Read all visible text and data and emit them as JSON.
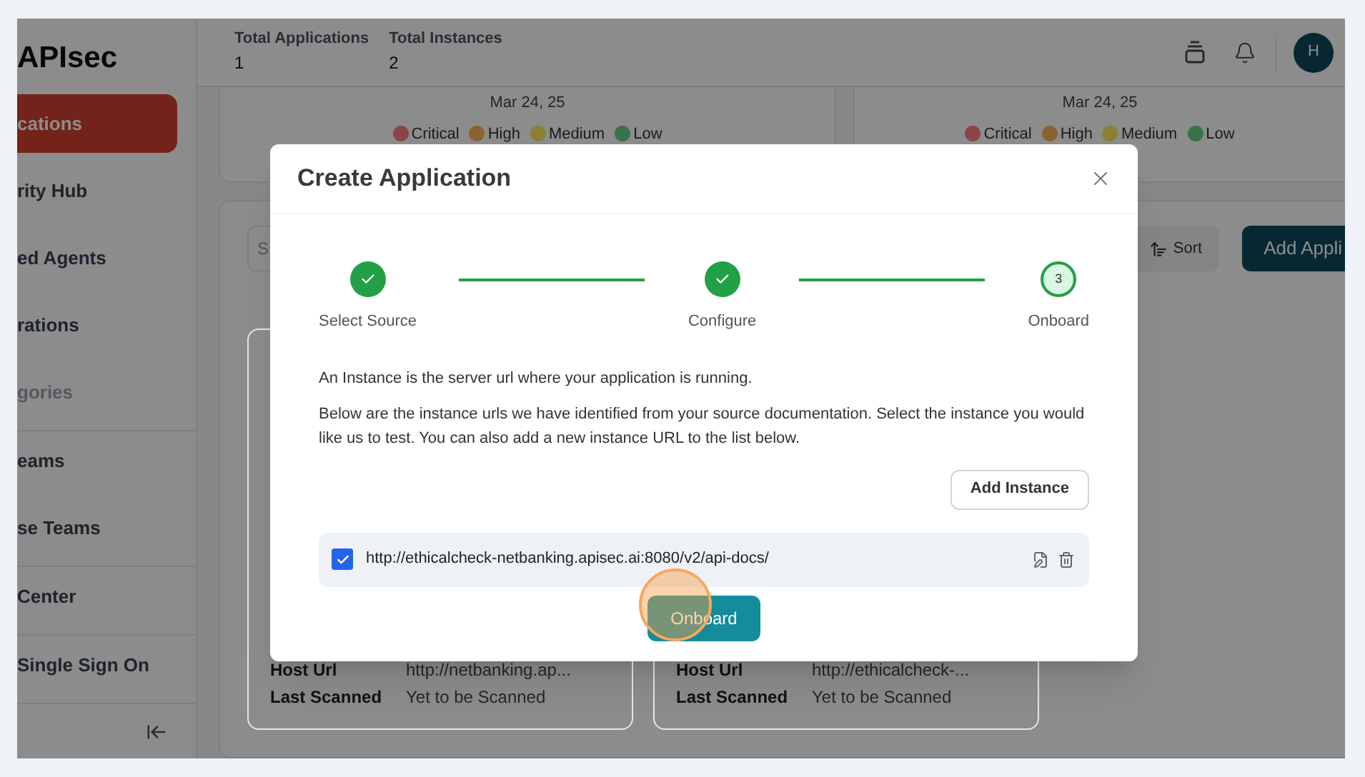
{
  "sidebar": {
    "logo": "APIsec",
    "items": [
      {
        "label": "cations",
        "selected": true,
        "disabled": false
      },
      {
        "label": "rity Hub",
        "selected": false,
        "disabled": false
      },
      {
        "label": "ed Agents",
        "selected": false,
        "disabled": false
      },
      {
        "label": "rations",
        "selected": false,
        "disabled": false
      },
      {
        "label": "gories",
        "selected": false,
        "disabled": true
      },
      {
        "label": "eams",
        "selected": false,
        "disabled": false
      },
      {
        "label": "se Teams",
        "selected": false,
        "disabled": false
      },
      {
        "label": "Center",
        "selected": false,
        "disabled": false
      },
      {
        "label": "Single Sign On",
        "selected": false,
        "disabled": false
      }
    ]
  },
  "header": {
    "stats": [
      {
        "label": "Total Applications",
        "value": "1"
      },
      {
        "label": "Total Instances",
        "value": "2"
      }
    ],
    "avatar": "H"
  },
  "charts": [
    {
      "date": "Mar 24, 25",
      "legend": [
        {
          "label": "Critical",
          "color": "#8a4646"
        },
        {
          "label": "High",
          "color": "#8a6332"
        },
        {
          "label": "Medium",
          "color": "#8c8034"
        },
        {
          "label": "Low",
          "color": "#3a7249"
        }
      ]
    },
    {
      "date": "Mar 24, 25",
      "legend": [
        {
          "label": "Critical",
          "color": "#8a4646"
        },
        {
          "label": "High",
          "color": "#8a6332"
        },
        {
          "label": "Medium",
          "color": "#8c8034"
        },
        {
          "label": "Low",
          "color": "#3a7249"
        }
      ]
    }
  ],
  "toolbar": {
    "search_placeholder": "S",
    "sort": "Sort",
    "add_button": "Add Appli"
  },
  "app_cards": [
    {
      "fields": [
        {
          "label": "Host Url",
          "value": "http://netbanking.ap..."
        },
        {
          "label": "Last Scanned",
          "value": "Yet to be Scanned"
        }
      ]
    },
    {
      "fields": [
        {
          "label": "Host Url",
          "value": "http://ethicalcheck-..."
        },
        {
          "label": "Last Scanned",
          "value": "Yet to be Scanned"
        }
      ]
    }
  ],
  "dialog": {
    "title": "Create Application",
    "steps": [
      {
        "label": "Select Source",
        "kind": "done"
      },
      {
        "label": "Configure",
        "kind": "done"
      },
      {
        "label": "Onboard",
        "kind": "current",
        "number": "3"
      }
    ],
    "paragraphs": [
      "An Instance is the server url where your application is running.",
      "Below are the instance urls we have identified from your source documentation. Select the instance you would like us to test. You can also add a new instance URL to the list below."
    ],
    "add_instance": "Add Instance",
    "instances": [
      {
        "url": "http://ethicalcheck-netbanking.apisec.ai:8080/v2/api-docs/",
        "checked": true
      }
    ],
    "submit": "Onboard"
  }
}
